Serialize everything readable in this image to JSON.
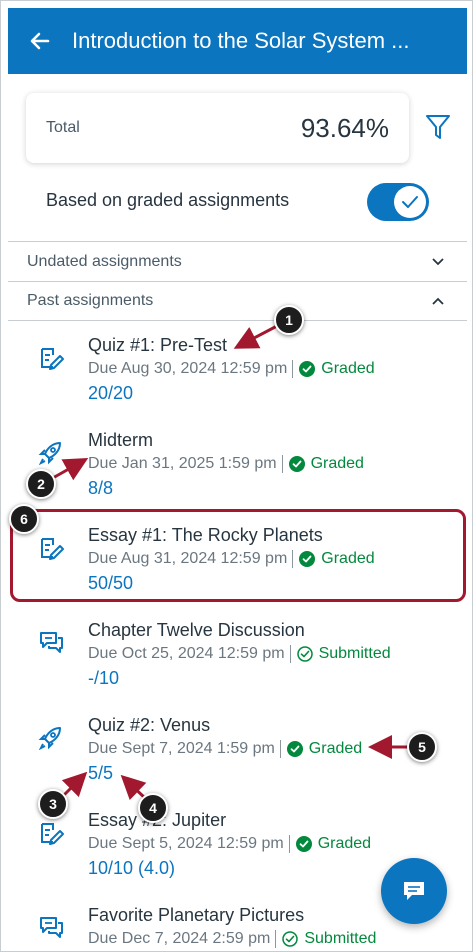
{
  "header": {
    "title": "Introduction to the Solar System ..."
  },
  "summary": {
    "total_label": "Total",
    "total_value": "93.64%"
  },
  "toggle": {
    "label": "Based on graded assignments",
    "enabled": true
  },
  "sections": {
    "undated": "Undated assignments",
    "past": "Past assignments"
  },
  "assignments": [
    {
      "name": "Quiz #1: Pre-Test",
      "due": "Due Aug 30, 2024 12:59 pm",
      "status": "Graded",
      "score": "20/20",
      "icon": "quiz-icon"
    },
    {
      "name": "Midterm",
      "due": "Due Jan 31, 2025 1:59 pm",
      "status": "Graded",
      "score": "8/8",
      "icon": "rocket-icon"
    },
    {
      "name": "Essay #1: The Rocky Planets",
      "due": "Due Aug 31, 2024 12:59 pm",
      "status": "Graded",
      "score": "50/50",
      "icon": "assignment-icon"
    },
    {
      "name": "Chapter Twelve Discussion",
      "due": "Due Oct 25, 2024 12:59 pm",
      "status": "Submitted",
      "score": "-/10",
      "icon": "discussion-icon"
    },
    {
      "name": "Quiz #2: Venus",
      "due": "Due Sept 7, 2024 1:59 pm",
      "status": "Graded",
      "score": "5/5",
      "icon": "rocket-icon"
    },
    {
      "name": "Essay #2: Jupiter",
      "due": "Due Sept 5, 2024 12:59 pm",
      "status": "Graded",
      "score": "10/10 (4.0)",
      "icon": "assignment-icon"
    },
    {
      "name": "Favorite Planetary Pictures",
      "due": "Due Dec 7, 2024 2:59 pm",
      "status": "Submitted",
      "score": "",
      "icon": "discussion-icon"
    }
  ],
  "callouts": [
    "1",
    "2",
    "3",
    "4",
    "5",
    "6"
  ],
  "colors": {
    "brand": "#0b75c0",
    "graded": "#03893d",
    "callout_arrow": "#a2192f"
  }
}
